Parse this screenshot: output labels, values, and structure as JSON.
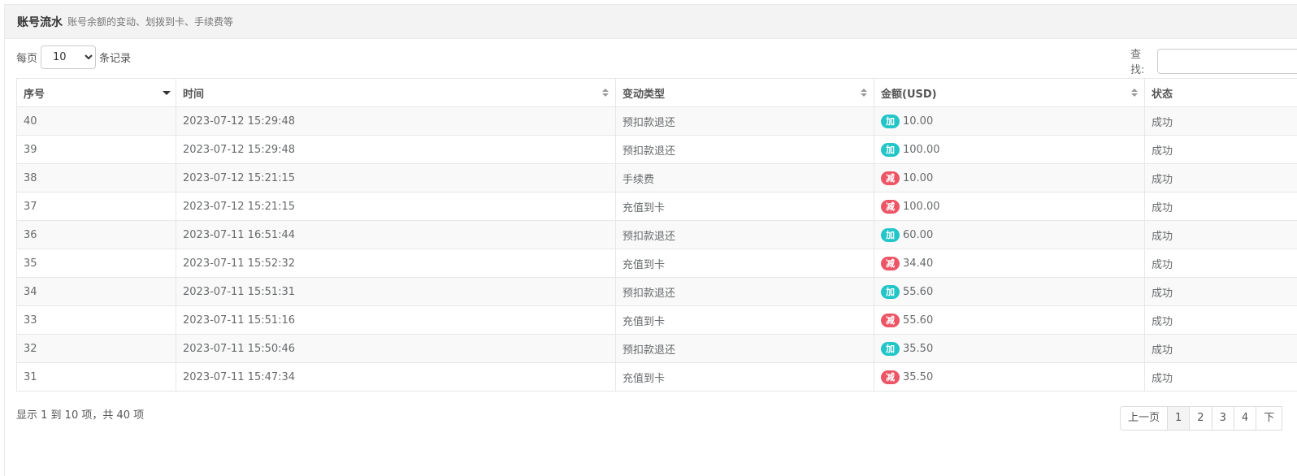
{
  "header": {
    "title": "账号流水",
    "subtitle": "账号余额的变动、划拨到卡、手续费等"
  },
  "length": {
    "prefix": "每页",
    "value": "10",
    "suffix": "条记录"
  },
  "search": {
    "label": "查找:"
  },
  "columns": [
    "序号",
    "时间",
    "变动类型",
    "金额(USD)",
    "状态"
  ],
  "rows": [
    {
      "id": "40",
      "time": "2023-07-12 15:29:48",
      "type": "预扣款退还",
      "badge": "加",
      "badge_kind": "plus",
      "amount": "10.00",
      "status": "成功"
    },
    {
      "id": "39",
      "time": "2023-07-12 15:29:48",
      "type": "预扣款退还",
      "badge": "加",
      "badge_kind": "plus",
      "amount": "100.00",
      "status": "成功"
    },
    {
      "id": "38",
      "time": "2023-07-12 15:21:15",
      "type": "手续费",
      "badge": "减",
      "badge_kind": "minus",
      "amount": "10.00",
      "status": "成功"
    },
    {
      "id": "37",
      "time": "2023-07-12 15:21:15",
      "type": "充值到卡",
      "badge": "减",
      "badge_kind": "minus",
      "amount": "100.00",
      "status": "成功"
    },
    {
      "id": "36",
      "time": "2023-07-11 16:51:44",
      "type": "预扣款退还",
      "badge": "加",
      "badge_kind": "plus",
      "amount": "60.00",
      "status": "成功"
    },
    {
      "id": "35",
      "time": "2023-07-11 15:52:32",
      "type": "充值到卡",
      "badge": "减",
      "badge_kind": "minus",
      "amount": "34.40",
      "status": "成功"
    },
    {
      "id": "34",
      "time": "2023-07-11 15:51:31",
      "type": "预扣款退还",
      "badge": "加",
      "badge_kind": "plus",
      "amount": "55.60",
      "status": "成功"
    },
    {
      "id": "33",
      "time": "2023-07-11 15:51:16",
      "type": "充值到卡",
      "badge": "减",
      "badge_kind": "minus",
      "amount": "55.60",
      "status": "成功"
    },
    {
      "id": "32",
      "time": "2023-07-11 15:50:46",
      "type": "预扣款退还",
      "badge": "加",
      "badge_kind": "plus",
      "amount": "35.50",
      "status": "成功"
    },
    {
      "id": "31",
      "time": "2023-07-11 15:47:34",
      "type": "充值到卡",
      "badge": "减",
      "badge_kind": "minus",
      "amount": "35.50",
      "status": "成功"
    }
  ],
  "info": "显示 1 到 10 项，共 40 项",
  "pagination": {
    "prev": "上一页",
    "pages": [
      "1",
      "2",
      "3",
      "4"
    ],
    "active": "1",
    "next": "下"
  },
  "colors": {
    "plus_badge": "#23c6c8",
    "minus_badge": "#ed5565"
  }
}
